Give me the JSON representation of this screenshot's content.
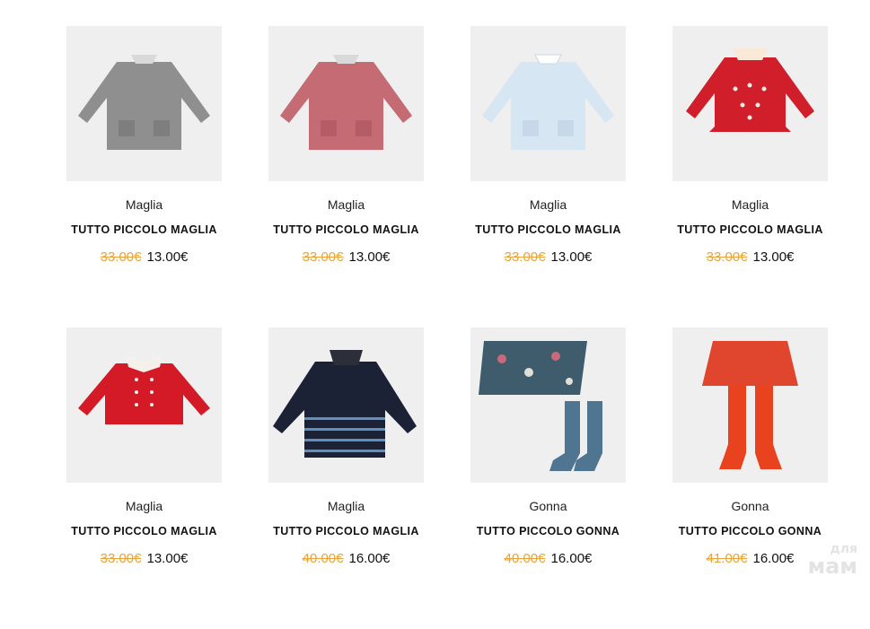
{
  "products": [
    {
      "category": "Maglia",
      "name": "TUTTO PICCOLO MAGLIA",
      "old_price": "33.00€",
      "price": "13.00€",
      "image": "grey-knit-sweater-icon",
      "color": "#8f8f8f",
      "accent": "#d9d9d9"
    },
    {
      "category": "Maglia",
      "name": "TUTTO PICCOLO MAGLIA",
      "old_price": "33.00€",
      "price": "13.00€",
      "image": "rose-knit-sweater-icon",
      "color": "#c46b74",
      "accent": "#d9d9d9"
    },
    {
      "category": "Maglia",
      "name": "TUTTO PICCOLO MAGLIA",
      "old_price": "33.00€",
      "price": "13.00€",
      "image": "light-blue-knit-sweater-icon",
      "color": "#d7e6f3",
      "accent": "#ffffff"
    },
    {
      "category": "Maglia",
      "name": "TUTTO PICCOLO MAGLIA",
      "old_price": "33.00€",
      "price": "13.00€",
      "image": "red-knit-sweater-icon",
      "color": "#d01e2a",
      "accent": "#fbe9d8"
    },
    {
      "category": "Maglia",
      "name": "TUTTO PICCOLO MAGLIA",
      "old_price": "33.00€",
      "price": "13.00€",
      "image": "red-collar-sweater-icon",
      "color": "#d31a26",
      "accent": "#f4f0ea"
    },
    {
      "category": "Maglia",
      "name": "TUTTO PICCOLO MAGLIA",
      "old_price": "40.00€",
      "price": "16.00€",
      "image": "navy-striped-sweater-icon",
      "color": "#1b2236",
      "accent": "#5f8fbf"
    },
    {
      "category": "Gonna",
      "name": "TUTTO PICCOLO GONNA",
      "old_price": "40.00€",
      "price": "16.00€",
      "image": "floral-skirt-with-socks-icon",
      "color": "#3f5c6c",
      "accent": "#4f7590"
    },
    {
      "category": "Gonna",
      "name": "TUTTO PICCOLO GONNA",
      "old_price": "41.00€",
      "price": "16.00€",
      "image": "red-skirt-with-tights-icon",
      "color": "#e0452e",
      "accent": "#e9421f"
    }
  ],
  "watermark": {
    "line1": "для",
    "line2": "мам"
  }
}
